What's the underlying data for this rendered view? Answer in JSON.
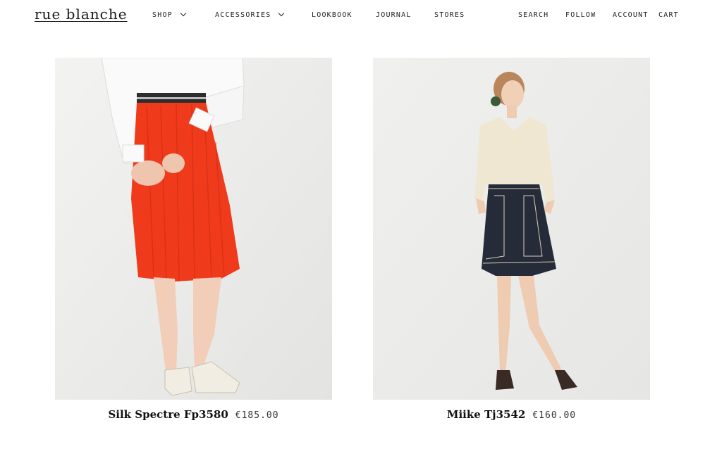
{
  "brand": {
    "name": "rue blanche"
  },
  "nav": {
    "shop": "SHOP",
    "accessories": "ACCESSORIES",
    "lookbook": "LOOKBOOK",
    "journal": "JOURNAL",
    "stores": "STORES",
    "search": "SEARCH",
    "follow": "FOLLOW",
    "account": "ACCOUNT",
    "cart": "CART"
  },
  "products": [
    {
      "name": "Silk Spectre Fp3580",
      "price": "€185.00"
    },
    {
      "name": "Miike Tj3542",
      "price": "€160.00"
    }
  ],
  "colors": {
    "skirt_red": "#f03a1c",
    "denim": "#262b3a",
    "sweater": "#efe7d2",
    "background": "#ececea"
  }
}
